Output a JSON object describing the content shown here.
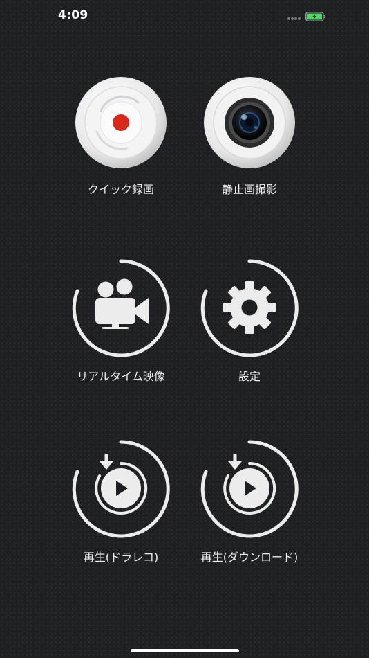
{
  "status_bar": {
    "time": "4:09",
    "battery_color": "#4cd964",
    "icons": [
      "signal-icon",
      "battery-charging-icon"
    ]
  },
  "menu": {
    "quick_record": {
      "label": "クイック録画",
      "icon": "record-button-icon",
      "accent": "#d9281c"
    },
    "still_capture": {
      "label": "静止画撮影",
      "icon": "camera-lens-icon"
    },
    "realtime_video": {
      "label": "リアルタイム映像",
      "icon": "video-camera-icon"
    },
    "settings": {
      "label": "設定",
      "icon": "gear-icon"
    },
    "playback_dashcam": {
      "label": "再生(ドラレコ)",
      "icon": "play-download-icon"
    },
    "playback_download": {
      "label": "再生(ダウンロード)",
      "icon": "play-download-icon"
    }
  },
  "colors": {
    "background": "#1f2023",
    "icon_fg": "#ececec",
    "label": "#eeeeee"
  }
}
